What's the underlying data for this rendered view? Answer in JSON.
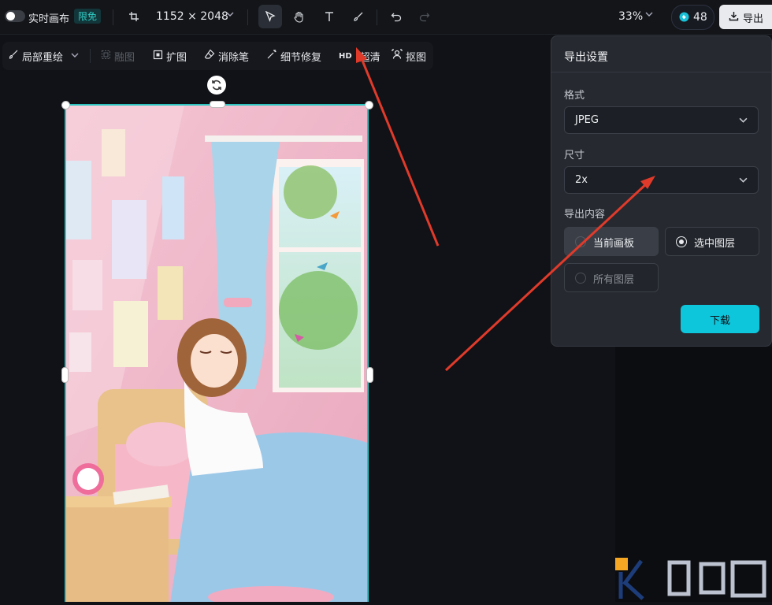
{
  "topbar": {
    "realtime_label": "实时画布",
    "badge": "限免",
    "size": "1152 × 2048",
    "zoom": "33%",
    "credits": "48",
    "export_label": "导出"
  },
  "toolbar": {
    "items": [
      {
        "label": "局部重绘",
        "icon": "brush-sparkle-icon"
      },
      {
        "label": "融图",
        "icon": "blend-icon",
        "disabled": true
      },
      {
        "label": "扩图",
        "icon": "expand-icon"
      },
      {
        "label": "消除笔",
        "icon": "eraser-icon"
      },
      {
        "label": "细节修复",
        "icon": "magic-wand-icon"
      },
      {
        "label": "超清",
        "icon": "hd-icon",
        "prefix": "HD"
      },
      {
        "label": "抠图",
        "icon": "cutout-icon"
      }
    ]
  },
  "export_panel": {
    "title": "导出设置",
    "format_label": "格式",
    "format_value": "JPEG",
    "size_label": "尺寸",
    "size_value": "2x",
    "content_label": "导出内容",
    "options": [
      {
        "label": "当前画板",
        "state": "selected-disabled"
      },
      {
        "label": "选中图层",
        "state": "checked"
      },
      {
        "label": "所有图层",
        "state": "disabled"
      }
    ],
    "download_label": "下载"
  },
  "colors": {
    "accent": "#0dc6dc",
    "selection": "#2dc4c0",
    "annotation_arrow": "#e03a2a"
  }
}
